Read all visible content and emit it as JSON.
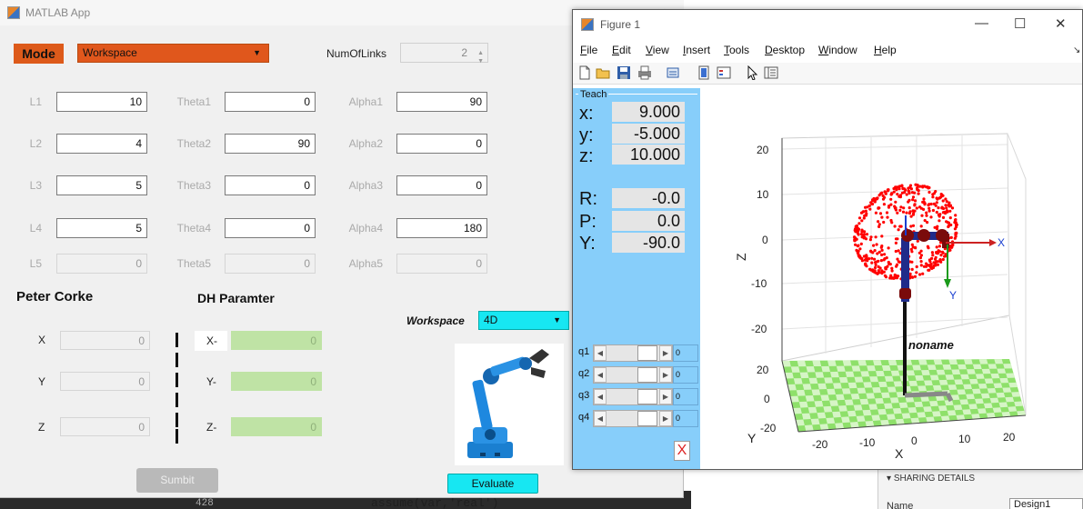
{
  "background": {
    "code_line": "428",
    "code_text": "assume(var,'real')",
    "sharing_details": "SHARING DETAILS",
    "name_label": "Name",
    "name_value": "Design1"
  },
  "app": {
    "title": "MATLAB App",
    "mode_label": "Mode",
    "mode_value": "Workspace",
    "numlinks_label": "NumOfLinks",
    "numlinks_value": "2",
    "rows": [
      {
        "l_label": "L1",
        "l_value": "10",
        "theta_label": "Theta1",
        "theta_value": "0",
        "alpha_label": "Alpha1",
        "alpha_value": "90"
      },
      {
        "l_label": "L2",
        "l_value": "4",
        "theta_label": "Theta2",
        "theta_value": "90",
        "alpha_label": "Alpha2",
        "alpha_value": "0"
      },
      {
        "l_label": "L3",
        "l_value": "5",
        "theta_label": "Theta3",
        "theta_value": "0",
        "alpha_label": "Alpha3",
        "alpha_value": "0"
      },
      {
        "l_label": "L4",
        "l_value": "5",
        "theta_label": "Theta4",
        "theta_value": "0",
        "alpha_label": "Alpha4",
        "alpha_value": "180"
      },
      {
        "l_label": "L5",
        "l_value": "0",
        "theta_label": "Theta5",
        "theta_value": "0",
        "alpha_label": "Alpha5",
        "alpha_value": "0"
      }
    ],
    "peter_corke": {
      "title": "Peter Corke",
      "x_label": "X",
      "x_value": "0",
      "y_label": "Y",
      "y_value": "0",
      "z_label": "Z",
      "z_value": "0"
    },
    "dh": {
      "title": "DH Paramter",
      "x_label": "X-",
      "x_value": "0",
      "y_label": "Y-",
      "y_value": "0",
      "z_label": "Z-",
      "z_value": "0"
    },
    "submit_label": "Sumbit",
    "workspace_label": "Workspace",
    "workspace_value": "4D",
    "evaluate_label": "Evaluate"
  },
  "figure": {
    "title": "Figure 1",
    "menus": [
      {
        "u": "F",
        "rest": "ile"
      },
      {
        "u": "E",
        "rest": "dit"
      },
      {
        "u": "V",
        "rest": "iew"
      },
      {
        "u": "I",
        "rest": "nsert"
      },
      {
        "u": "T",
        "rest": "ools"
      },
      {
        "u": "D",
        "rest": "esktop"
      },
      {
        "u": "W",
        "rest": "indow"
      },
      {
        "u": "H",
        "rest": "elp"
      }
    ],
    "teach": {
      "title": "Teach",
      "x_label": "x:",
      "x_value": "9.000",
      "y_label": "y:",
      "y_value": "-5.000",
      "z_label": "z:",
      "z_value": "10.000",
      "r_label": "R:",
      "r_value": "-0.0",
      "p_label": "P:",
      "p_value": "0.0",
      "yaw_label": "Y:",
      "yaw_value": "-90.0",
      "joints": [
        {
          "label": "q1",
          "value": "0"
        },
        {
          "label": "q2",
          "value": "0"
        },
        {
          "label": "q3",
          "value": "0"
        },
        {
          "label": "q4",
          "value": "0"
        }
      ],
      "close_label": "X"
    },
    "plot": {
      "z_ticks": [
        "20",
        "10",
        "0",
        "-10",
        "-20"
      ],
      "y_ticks": [
        "20",
        "0",
        "-20"
      ],
      "x_ticks": [
        "-20",
        "-10",
        "0",
        "10",
        "20"
      ],
      "z_axis": "Z",
      "y_axis": "Y",
      "x_axis": "X",
      "robot_name": "noname",
      "frame_x": "X",
      "frame_y": "Y",
      "colors": {
        "points": "#ff0000",
        "floor": "#8ee06a",
        "link": "#111111",
        "joint": "#7a0b0b"
      }
    }
  }
}
